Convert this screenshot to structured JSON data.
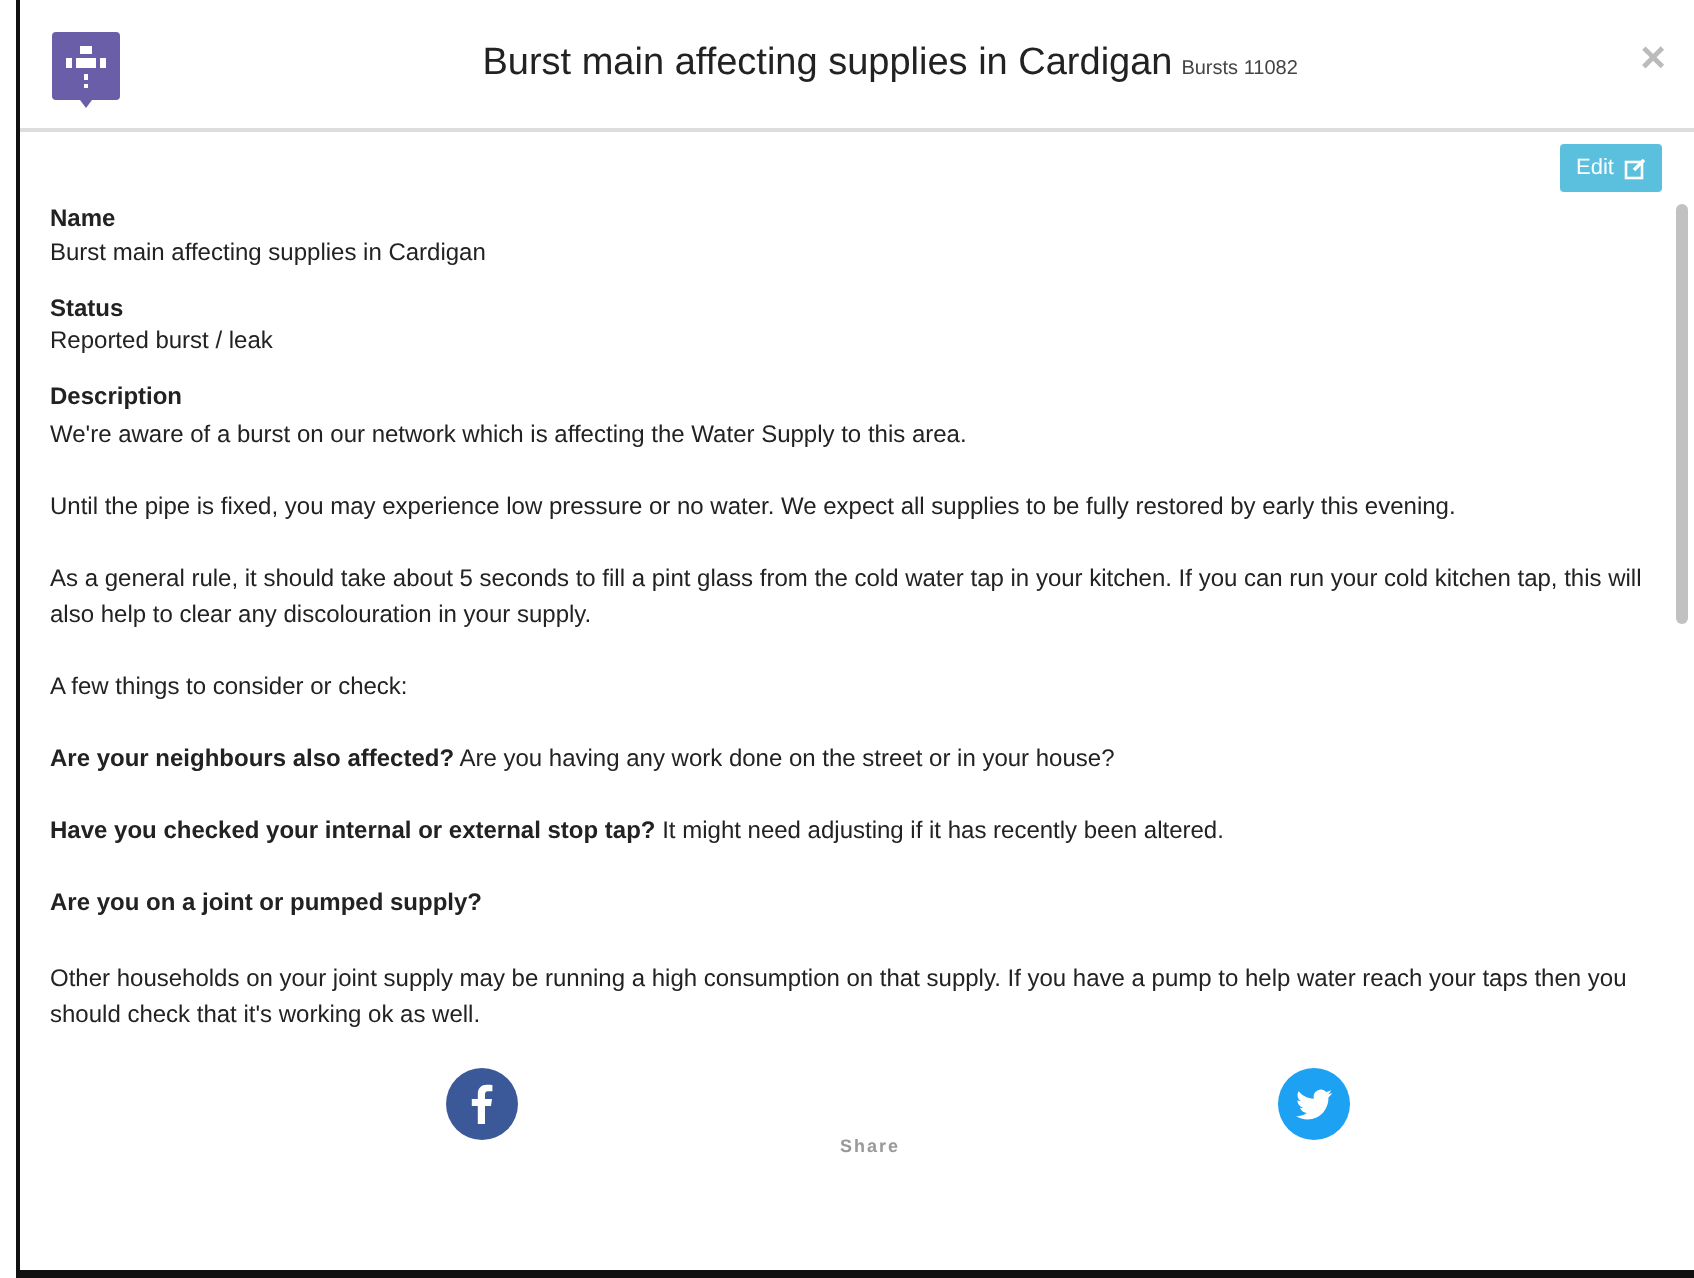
{
  "header": {
    "title": "Burst main affecting supplies in Cardigan",
    "subtitle": "Bursts 11082",
    "close": "×"
  },
  "edit_button": {
    "label": "Edit"
  },
  "fields": [
    {
      "label": "Name",
      "value": "Burst main affecting supplies in Cardigan"
    },
    {
      "label": "Status",
      "value": "Reported burst / leak"
    }
  ],
  "description": {
    "label": "Description",
    "paragraphs": [
      {
        "kind": "text",
        "text": "We're aware of a burst on our network which is affecting the Water Supply to this area."
      },
      {
        "kind": "text",
        "text": "Until the pipe is fixed, you may experience low pressure or no water. We expect all supplies to be fully restored by early this evening."
      },
      {
        "kind": "text",
        "text": "As a general rule, it should take about 5 seconds to fill a pint glass from the cold water tap in your kitchen. If you can run your cold kitchen tap, this will also help to clear any discolouration in your supply."
      },
      {
        "kind": "text",
        "text": "A few things to consider or check:"
      },
      {
        "kind": "text",
        "text": "**Are your neighbours also affected?** Are you having any work done on the street or in your house?"
      },
      {
        "kind": "text",
        "text": "**Have you checked your internal or external stop tap?** It might need adjusting if it has recently been altered."
      },
      {
        "kind": "heading",
        "text": "Are you on a joint or pumped supply?"
      },
      {
        "kind": "text",
        "text": "Other households on your joint supply may be running a high consumption on that supply. If you have a pump to help water reach your taps then you should check that it's working ok as well."
      }
    ]
  },
  "share": {
    "label": "Share"
  }
}
